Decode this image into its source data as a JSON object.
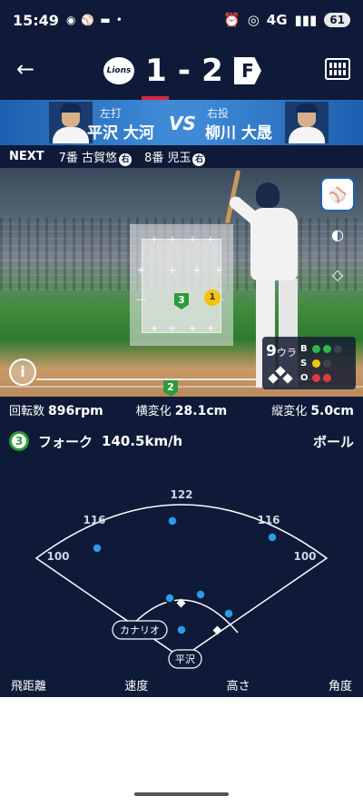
{
  "status_bar": {
    "time": "15:49",
    "network": "4G",
    "battery": "61"
  },
  "score": {
    "home": "1",
    "separator": "-",
    "away": "2",
    "home_logo_text": "Lions",
    "away_logo_text": "F"
  },
  "matchup": {
    "batter_hand": "左打",
    "batter_name": "平沢 大河",
    "vs": "VS",
    "pitcher_hand": "右投",
    "pitcher_name": "柳川 大晟"
  },
  "next": {
    "label": "NEXT",
    "players": [
      {
        "order": "7番 古賀悠",
        "hand": "右"
      },
      {
        "order": "8番 児玉",
        "hand": "右"
      }
    ]
  },
  "strike_zone": {
    "prev_pitch": "3",
    "current_pitch": "1",
    "bottom_marker": "2"
  },
  "count": {
    "inning": "9",
    "half": "ウラ",
    "balls": 2,
    "strikes": 1,
    "outs": 2,
    "colors": {
      "ball": "#2eb84a",
      "strike": "#f2c30f",
      "out": "#e23b3b",
      "off": "#3a4250"
    }
  },
  "metrics": {
    "spin_label": "回転数",
    "spin_value": "896rpm",
    "hbreak_label": "横変化",
    "hbreak_value": "28.1cm",
    "vbreak_label": "縦変化",
    "vbreak_value": "5.0cm"
  },
  "pitch": {
    "number": "3",
    "type": "フォーク",
    "speed": "140.5km/h",
    "result": "ボール"
  },
  "spray": {
    "distance_labels": [
      "122",
      "116",
      "116",
      "100",
      "100"
    ],
    "player_tags": [
      "カナリオ",
      "平沢"
    ]
  },
  "columns": [
    "飛距離",
    "速度",
    "高さ",
    "角度"
  ]
}
